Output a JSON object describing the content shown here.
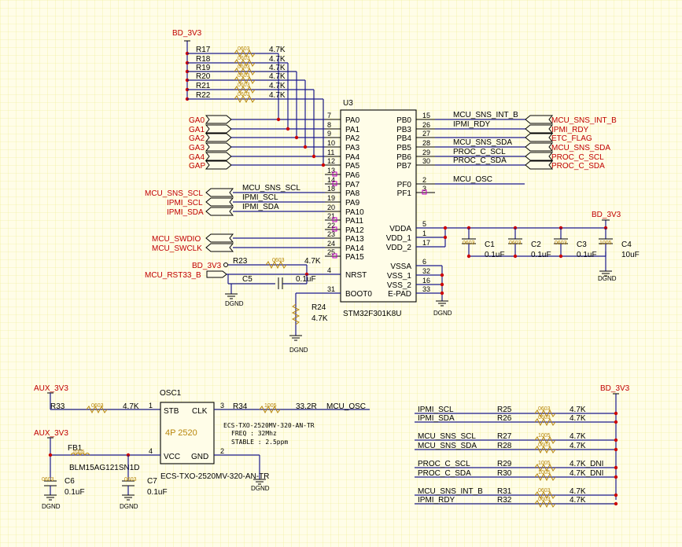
{
  "rails": {
    "bd_3v3": "BD_3V3",
    "aux_3v3": "AUX_3V3",
    "gnd": "DGND"
  },
  "pullups": [
    {
      "ref": "R17",
      "pkg": "0603",
      "val": "4.7K"
    },
    {
      "ref": "R18",
      "pkg": "0603",
      "val": "4.7K"
    },
    {
      "ref": "R19",
      "pkg": "0603",
      "val": "4.7K"
    },
    {
      "ref": "R20",
      "pkg": "0603",
      "val": "4.7K"
    },
    {
      "ref": "R21",
      "pkg": "0603",
      "val": "4.7K"
    },
    {
      "ref": "R22",
      "pkg": "0603",
      "val": "4.7K"
    }
  ],
  "ga_ports": [
    "GA0",
    "GA1",
    "GA2",
    "GA3",
    "GA4",
    "GAP"
  ],
  "mcu": {
    "ref": "U3",
    "part": "STM32F301K8U",
    "left_pins": [
      {
        "num": "7",
        "name": "PA0"
      },
      {
        "num": "8",
        "name": "PA1"
      },
      {
        "num": "9",
        "name": "PA2"
      },
      {
        "num": "10",
        "name": "PA3"
      },
      {
        "num": "11",
        "name": "PA4"
      },
      {
        "num": "12",
        "name": "PA5"
      },
      {
        "num": "13",
        "name": "PA6"
      },
      {
        "num": "14",
        "name": "PA7"
      },
      {
        "num": "18",
        "name": "PA8"
      },
      {
        "num": "19",
        "name": "PA9"
      },
      {
        "num": "20",
        "name": "PA10"
      },
      {
        "num": "21",
        "name": "PA11"
      },
      {
        "num": "22",
        "name": "PA12"
      },
      {
        "num": "23",
        "name": "PA13"
      },
      {
        "num": "24",
        "name": "PA14"
      },
      {
        "num": "25",
        "name": "PA15"
      },
      {
        "num": "4",
        "name": "NRST"
      },
      {
        "num": "31",
        "name": "BOOT0"
      }
    ],
    "right_pins": [
      {
        "num": "15",
        "name": "PB0"
      },
      {
        "num": "26",
        "name": "PB3"
      },
      {
        "num": "27",
        "name": "PB4"
      },
      {
        "num": "28",
        "name": "PB5"
      },
      {
        "num": "29",
        "name": "PB6"
      },
      {
        "num": "30",
        "name": "PB7"
      },
      {
        "num": "2",
        "name": "PF0"
      },
      {
        "num": "3",
        "name": "PF1"
      },
      {
        "num": "5",
        "name": "VDDA"
      },
      {
        "num": "1",
        "name": "VDD_1"
      },
      {
        "num": "17",
        "name": "VDD_2"
      },
      {
        "num": "6",
        "name": "VSSA"
      },
      {
        "num": "32",
        "name": "VSS_1"
      },
      {
        "num": "16",
        "name": "VSS_2"
      },
      {
        "num": "33",
        "name": "E-PAD"
      }
    ]
  },
  "right_nets": [
    {
      "wire": "MCU_SNS_INT_B",
      "port": "MCU_SNS_INT_B"
    },
    {
      "wire": "IPMI_RDY",
      "port": "IPMI_RDY"
    },
    {
      "wire": "",
      "port": "ETC_FLAG"
    },
    {
      "wire": "MCU_SNS_SDA",
      "port": "MCU_SNS_SDA"
    },
    {
      "wire": "PROC_C_SCL",
      "port": "PROC_C_SCL"
    },
    {
      "wire": "PROC_C_SDA",
      "port": "PROC_C_SDA"
    },
    {
      "wire": "MCU_OSC",
      "port": ""
    }
  ],
  "left_nets": [
    {
      "port": "MCU_SNS_SCL",
      "wire": "MCU_SNS_SCL"
    },
    {
      "port": "IPMI_SCL",
      "wire": "IPMI_SCL"
    },
    {
      "port": "IPMI_SDA",
      "wire": "IPMI_SDA"
    },
    {
      "port": "MCU_SWDIO",
      "wire": ""
    },
    {
      "port": "MCU_SWCLK",
      "wire": ""
    }
  ],
  "reset": {
    "port": "MCU_RST33_B",
    "r_ref": "R23",
    "r_pkg": "0603",
    "r_val": "4.7K",
    "c_ref": "C5",
    "c_val": "0.1uF"
  },
  "boot": {
    "ref": "R24",
    "pkg": "0603",
    "val": "4.7K"
  },
  "decoupling": [
    {
      "ref": "C1",
      "pkg": "0603",
      "val": "0.1uF"
    },
    {
      "ref": "C2",
      "pkg": "0603",
      "val": "0.1uF"
    },
    {
      "ref": "C3",
      "pkg": "0603",
      "val": "0.1uF"
    },
    {
      "ref": "C4",
      "pkg": "1005",
      "val": "10uF"
    }
  ],
  "osc": {
    "ref": "OSC1",
    "body": "4P 2520",
    "pin_stb": "STB",
    "pin_clk": "CLK",
    "pin_vcc": "VCC",
    "pin_gnd": "GND",
    "n1": "1",
    "n3": "3",
    "n4": "4",
    "n2": "2",
    "part": "ECS-TXO-2520MV-320-AN-TR",
    "note_part": "ECS-TXO-2520MV-320-AN-TR",
    "note_freq": "FREQ : 32Mhz",
    "note_stable": "STABLE : 2.5ppm",
    "r33": {
      "ref": "R33",
      "pkg": "0603",
      "val": "4.7K"
    },
    "r34": {
      "ref": "R34",
      "pkg": "1005",
      "val": "33.2R"
    },
    "out_net": "MCU_OSC",
    "fb": {
      "ref": "FB1",
      "pkg": "1005",
      "part": "BLM15AG121SN1D"
    },
    "c6": {
      "ref": "C6",
      "pkg": "0603",
      "val": "0.1uF"
    },
    "c7": {
      "ref": "C7",
      "pkg": "0603",
      "val": "0.1uF"
    }
  },
  "bus_pullups": [
    {
      "net": "IPMI_SCL",
      "ref": "R25",
      "pkg": "0603",
      "val": "4.7K"
    },
    {
      "net": "IPMI_SDA",
      "ref": "R26",
      "pkg": "0603",
      "val": "4.7K"
    },
    {
      "net": "MCU_SNS_SCL",
      "ref": "R27",
      "pkg": "1005",
      "val": "4.7K"
    },
    {
      "net": "MCU_SNS_SDA",
      "ref": "R28",
      "pkg": "0603",
      "val": "4.7K"
    },
    {
      "net": "PROC_C_SCL",
      "ref": "R29",
      "pkg": "1005",
      "val": "4.7K_DNI"
    },
    {
      "net": "PROC_C_SDA",
      "ref": "R30",
      "pkg": "1005",
      "val": "4.7K_DNI"
    },
    {
      "net": "MCU_SNS_INT_B",
      "ref": "R31",
      "pkg": "0603",
      "val": "4.7K"
    },
    {
      "net": "IPMI_RDY",
      "ref": "R32",
      "pkg": "0603",
      "val": "4.7K"
    }
  ],
  "colors": {
    "background": "#fffde8",
    "grid": "#ecec86",
    "wire": "#1a1a8c",
    "net_label": "#c00000",
    "package": "#b8860b",
    "junction": "#cc0000"
  }
}
